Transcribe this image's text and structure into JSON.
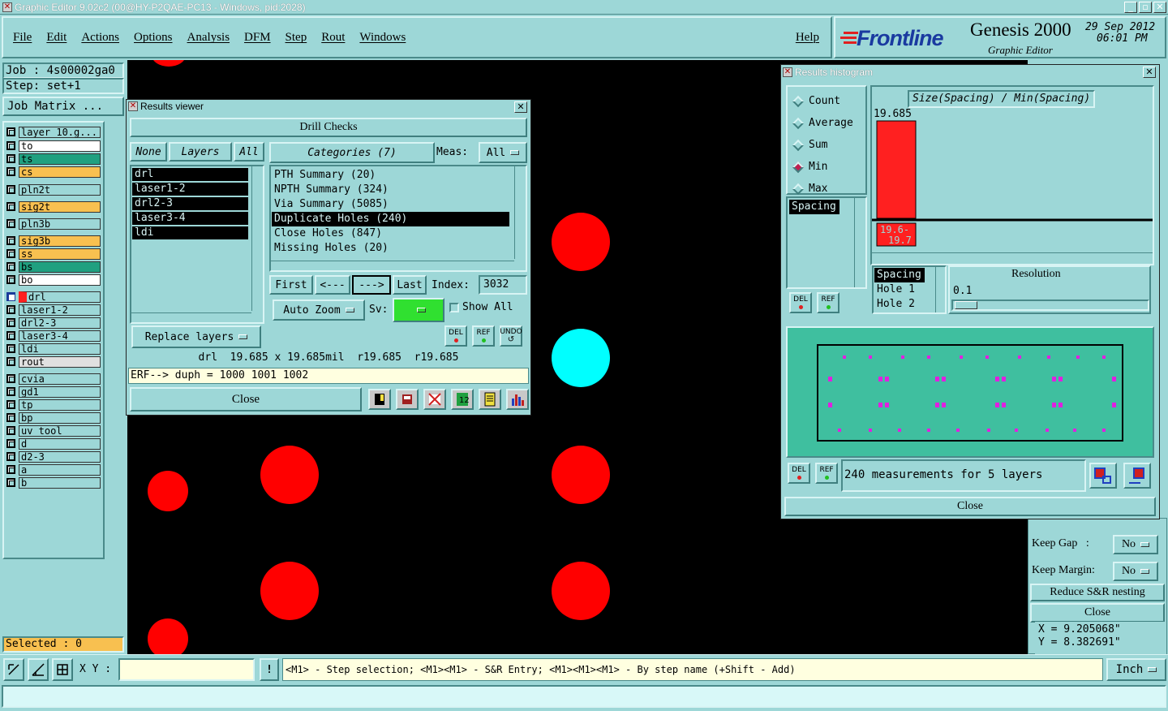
{
  "window": {
    "title": "Graphic Editor 9.02c2 (00@HY-P2QAE-PC13 - Windows, pid:2028)"
  },
  "menu": [
    "File",
    "Edit",
    "Actions",
    "Options",
    "Analysis",
    "DFM",
    "Step",
    "Rout",
    "Windows"
  ],
  "help": "Help",
  "brand": {
    "logo": "Frontline",
    "product": "Genesis 2000",
    "sub": "Graphic Editor",
    "date": "29 Sep 2012",
    "time": "06:01 PM"
  },
  "job": {
    "job_label": "Job : 4s00002ga0",
    "step_label": "Step: set+1",
    "matrix_button": "Job Matrix ..."
  },
  "layers": [
    {
      "name": "layer_10.g...",
      "color": "#9dd7d7"
    },
    {
      "name": "to",
      "color": "#ffffff"
    },
    {
      "name": "ts",
      "color": "#20a080"
    },
    {
      "name": "cs",
      "color": "#f8c050"
    },
    {
      "name": "pln2t",
      "color": "#9dd7d7"
    },
    {
      "name": "sig2t",
      "color": "#f8c050"
    },
    {
      "name": "pln3b",
      "color": "#9dd7d7"
    },
    {
      "name": "sig3b",
      "color": "#f8c050"
    },
    {
      "name": "ss",
      "color": "#f8c050"
    },
    {
      "name": "bs",
      "color": "#20a080"
    },
    {
      "name": "bo",
      "color": "#ffffff"
    },
    {
      "name": "drl",
      "color": "#9dd7d7"
    },
    {
      "name": "laser1-2",
      "color": "#9dd7d7"
    },
    {
      "name": "drl2-3",
      "color": "#9dd7d7"
    },
    {
      "name": "laser3-4",
      "color": "#9dd7d7"
    },
    {
      "name": "ldi",
      "color": "#9dd7d7"
    },
    {
      "name": "rout",
      "color": "#e0e0e0"
    },
    {
      "name": "cvia",
      "color": "#9dd7d7"
    },
    {
      "name": "gd1",
      "color": "#9dd7d7"
    },
    {
      "name": "tp",
      "color": "#9dd7d7"
    },
    {
      "name": "bp",
      "color": "#9dd7d7"
    },
    {
      "name": "uv_tool",
      "color": "#9dd7d7"
    },
    {
      "name": "d",
      "color": "#9dd7d7"
    },
    {
      "name": "d2-3",
      "color": "#9dd7d7"
    },
    {
      "name": "a",
      "color": "#9dd7d7"
    },
    {
      "name": "b",
      "color": "#9dd7d7"
    }
  ],
  "selected": "Selected : 0",
  "results_viewer": {
    "title": "Results viewer",
    "header": "Drill Checks",
    "none_btn": "None",
    "layers_btn": "Layers",
    "all_btn": "All",
    "layer_list": [
      "drl",
      "laser1-2",
      "drl2-3",
      "laser3-4",
      "ldi"
    ],
    "categories_btn": "Categories (7)",
    "meas_label": "Meas:",
    "meas_value": "All",
    "categories": [
      "PTH Summary (20)",
      "NPTH Summary (324)",
      "Via Summary (5085)",
      "Duplicate Holes (240)",
      "Close Holes (847)",
      "Missing Holes (20)"
    ],
    "first": "First",
    "prev": "<---",
    "next": "--->",
    "last": "Last",
    "index_label": "Index:",
    "index_value": "3032",
    "auto_zoom": "Auto Zoom",
    "sv_label": "Sv:",
    "show_all": "Show All",
    "replace_layers": "Replace layers",
    "del": "DEL",
    "ref": "REF",
    "undo": "UNDO",
    "measure_line": "drl  19.685 x 19.685mil  r19.685  r19.685",
    "erf_line": "ERF--> duph = 1000 1001 1002",
    "close": "Close"
  },
  "histogram": {
    "title": "Results histogram",
    "radios": [
      "Count",
      "Average",
      "Sum",
      "Min",
      "Max"
    ],
    "selected_radio": "Min",
    "chart_title": "Size(Spacing) / Min(Spacing)",
    "top_value": "19.685",
    "bin_label": "19.6- 19.7",
    "list_item": "Spacing",
    "fields": [
      "Spacing",
      "Hole 1",
      "Hole 2"
    ],
    "resolution_label": "Resolution",
    "resolution_value": "0.1",
    "del": "DEL",
    "ref": "REF",
    "summary": "240 measurements for 5 layers",
    "close": "Close"
  },
  "side_panel": {
    "keep_gap_label": "Keep Gap   :",
    "keep_gap_value": "No",
    "keep_margin_label": "Keep Margin:",
    "keep_margin_value": "No",
    "reduce_btn": "Reduce S&R nesting",
    "close": "Close",
    "coord_x": "X = 9.205068\"",
    "coord_y": "Y = 8.382691\""
  },
  "statusbar": {
    "xy_label": "X Y :",
    "xy_value": "",
    "hint": "<M1> - Step selection; <M1><M1> - S&R Entry; <M1><M1><M1> - By step name (+Shift - Add)",
    "units": "Inch"
  },
  "chart_data": {
    "type": "bar",
    "title": "Size(Spacing) / Min(Spacing)",
    "categories": [
      "19.6- 19.7"
    ],
    "values": [
      19.685
    ]
  },
  "colors": {
    "panel": "#9dd7d7",
    "titlebar": "#1a3a9a",
    "pad_red": "#ff0000",
    "pad_cyan": "#00ffff",
    "sv_green": "#30e030"
  }
}
